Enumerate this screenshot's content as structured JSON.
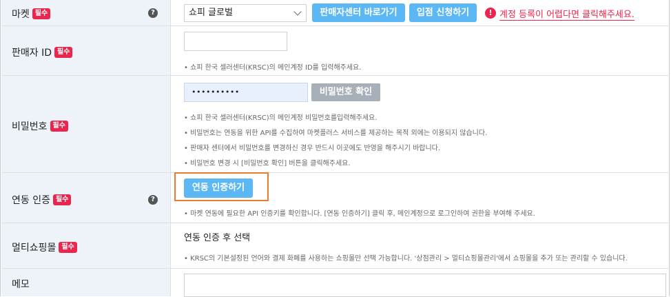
{
  "required_badge": "필수",
  "help_icon_glyph": "?",
  "warn_icon_glyph": "!",
  "colors": {
    "accent": "#5bb8f5",
    "required": "#e8264e",
    "label_bg": "#eef3fa",
    "highlight": "#f07a2c"
  },
  "market": {
    "label": "마켓",
    "select_value": "쇼피 글로벌",
    "seller_center_button": "판매자센터 바로가기",
    "apply_button": "입점 신청하기",
    "warning_link": "계정 등록이 어렵다면 클릭해주세요."
  },
  "seller_id": {
    "label": "판매자 ID",
    "value": "",
    "note": "• 쇼피 한국 셀러센터(KRSC)의 메인계정 ID를 입력해주세요."
  },
  "password": {
    "label": "비밀번호",
    "value": "••••••••••",
    "confirm_button": "비밀번호 확인",
    "notes": [
      "• 쇼피 한국 셀러센터(KRSC)의 메인계정 비밀번호를입력해주세요.",
      "• 비밀번호는 연동을 위한 API를 수집하여 마켓플러스 서비스를 제공하는 목적 외에는 이용되지 않습니다.",
      "• 판매자 센터에서 비밀번호를 변경하신 경우 반드시 이곳에도 반영을 해주시기 바랍니다.",
      "• 비밀번호 변경 시 [비밀번호 확인] 버튼을 클릭해주세요."
    ]
  },
  "auth": {
    "label": "연동 인증",
    "button": "연동 인증하기",
    "note": "• 마켓 연동에 필요한 API 인증키를 확인합니다. [연동 인증하기] 클릭 후, 메인계정으로 로그인하여 권한을 부여해 주세요."
  },
  "multi_mall": {
    "label": "멀티쇼핑몰",
    "status": "연동 인증 후 선택",
    "note": "• KRSC의 기본설정된 언어와 결제 화폐를 사용하는 쇼핑몰만 선택 가능합니다. '상점관리 > 멀티쇼핑몰관리'에서 쇼핑몰을 추가 또는 관리할 수 있습니다."
  },
  "memo": {
    "label": "메모",
    "value": ""
  }
}
